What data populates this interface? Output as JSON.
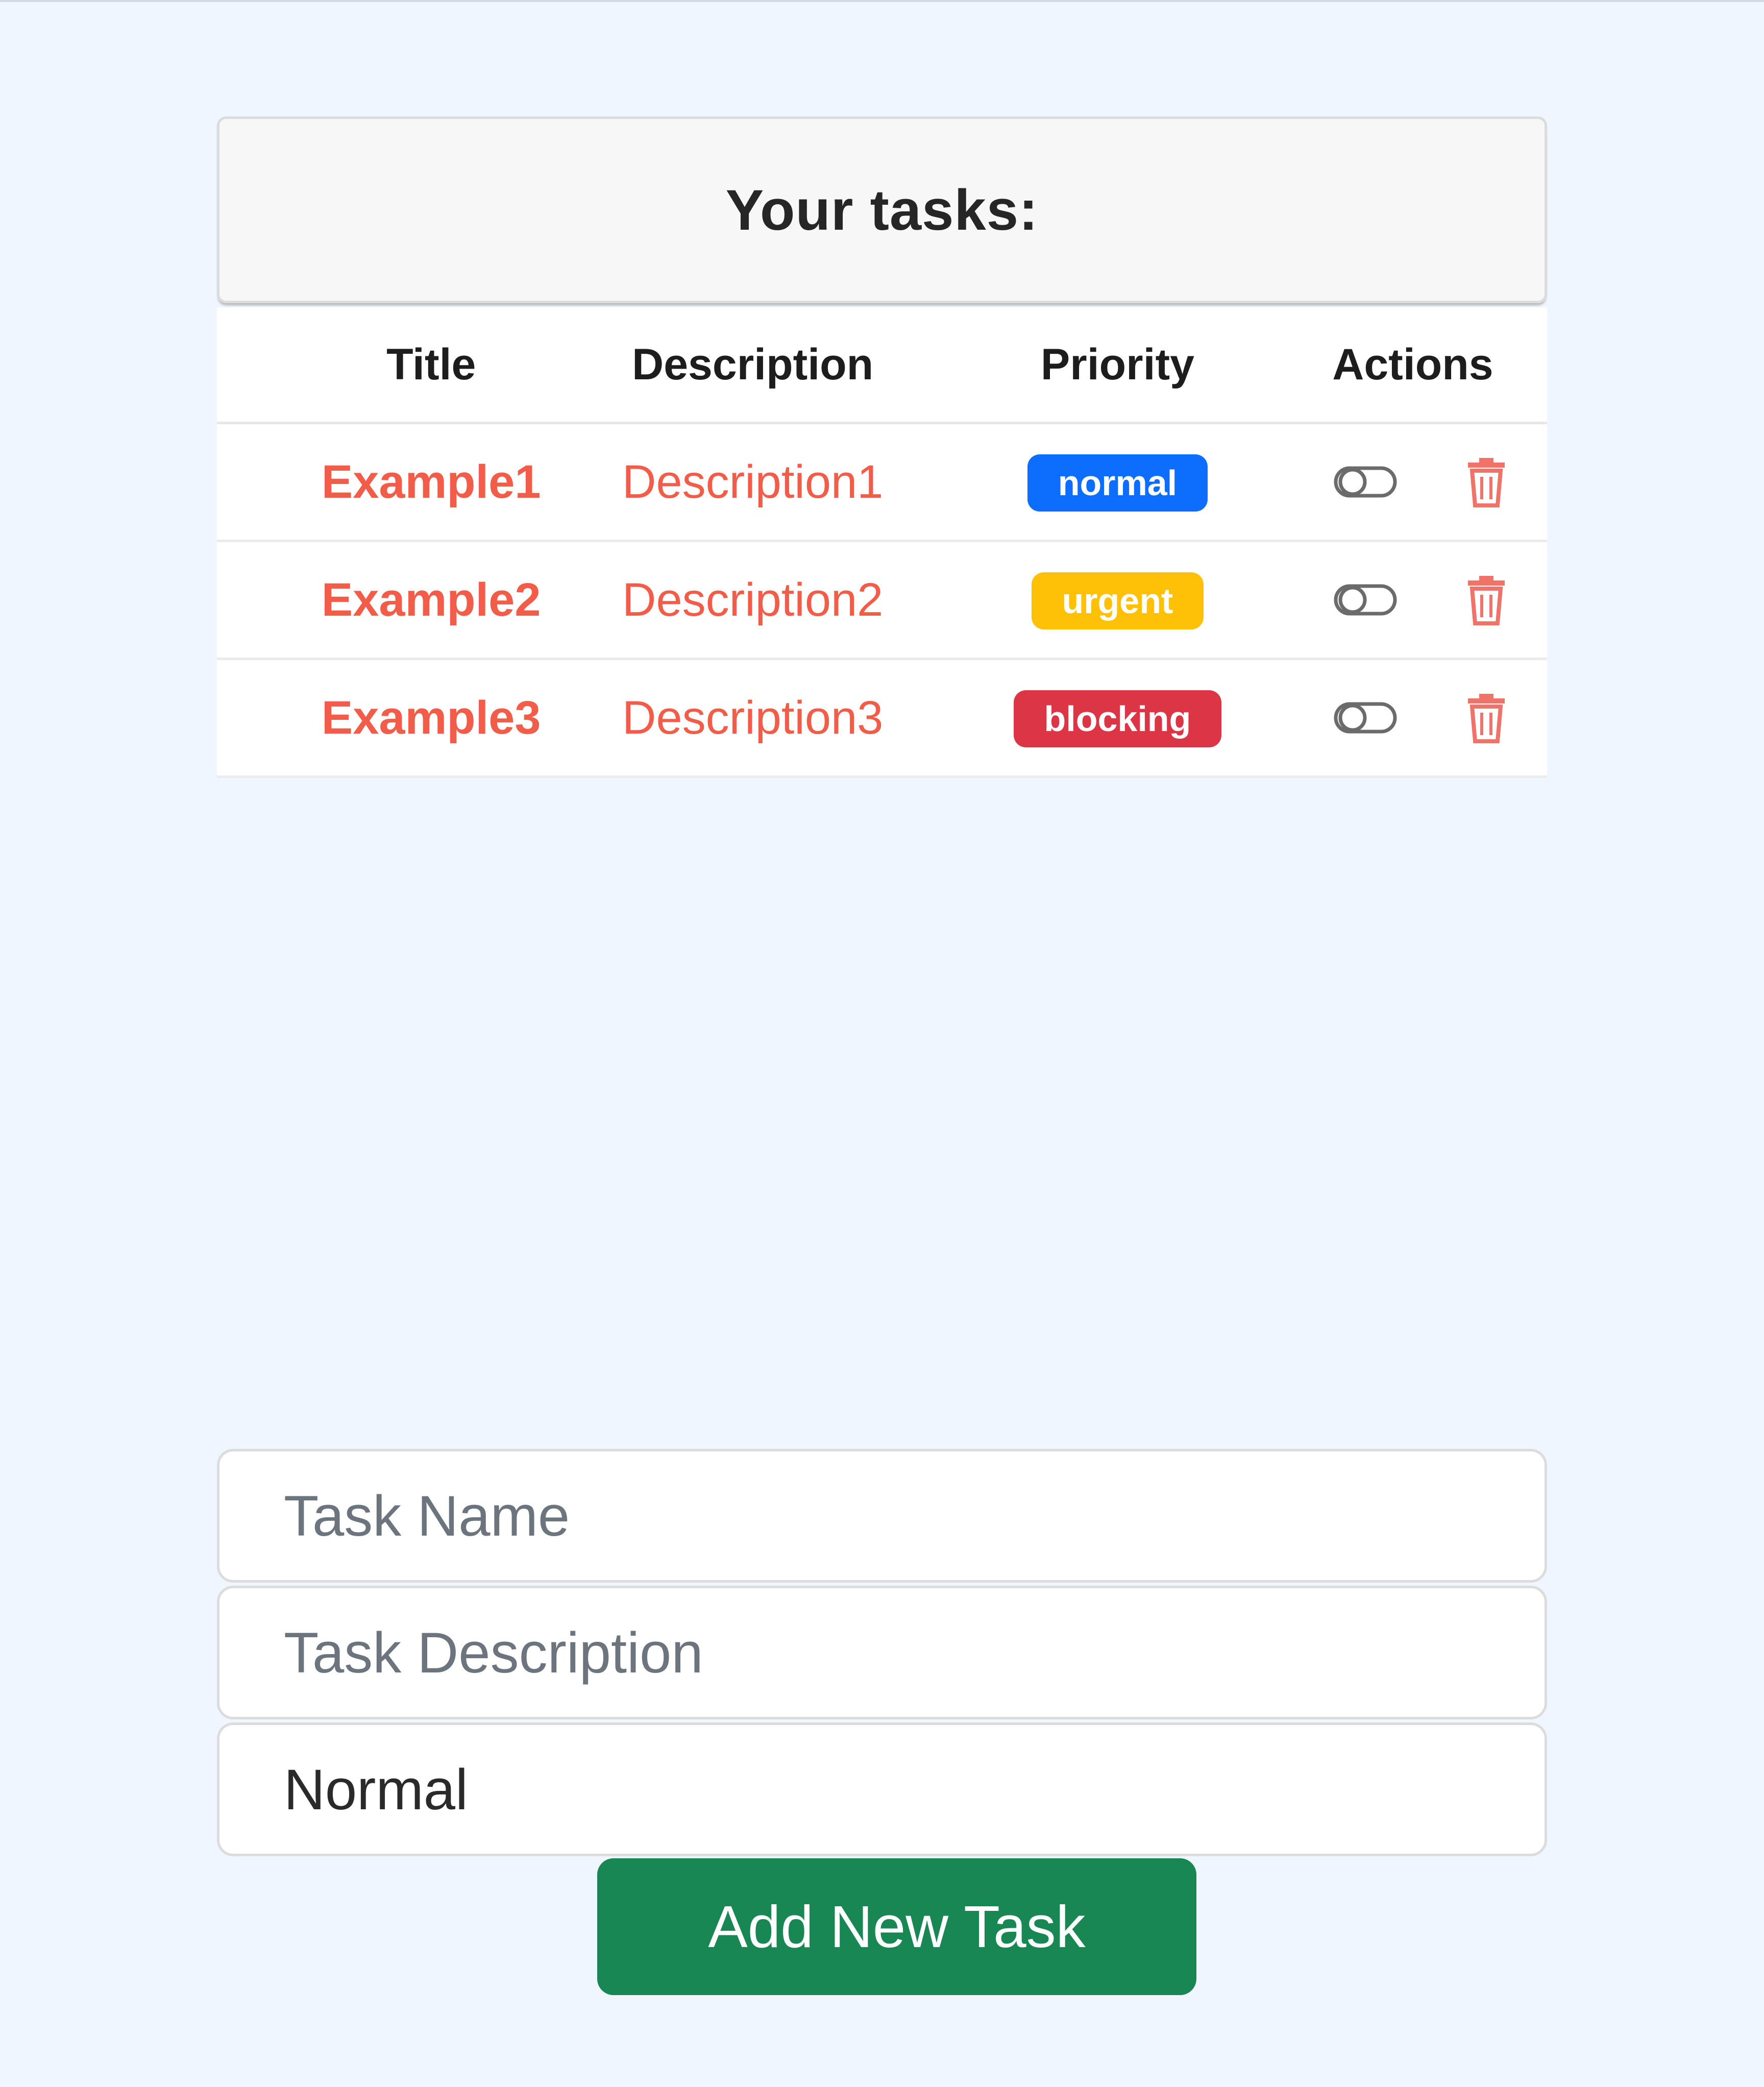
{
  "card": {
    "header": "Your tasks:"
  },
  "table": {
    "columns": [
      "Title",
      "Description",
      "Priority",
      "Actions"
    ],
    "rows": [
      {
        "title": "Example1",
        "description": "Description1",
        "priority": "normal",
        "priority_color": "#0d6efd"
      },
      {
        "title": "Example2",
        "description": "Description2",
        "priority": "urgent",
        "priority_color": "#ffc107"
      },
      {
        "title": "Example3",
        "description": "Description3",
        "priority": "blocking",
        "priority_color": "#dc3545"
      }
    ],
    "action_icons": [
      "toggle-icon",
      "trash-icon"
    ]
  },
  "form": {
    "name_placeholder": "Task Name",
    "description_placeholder": "Task Description",
    "priority_value": "Normal",
    "submit_label": "Add New Task"
  },
  "colors": {
    "background": "#eff6ff",
    "title_text": "#f25d4a",
    "submit": "#198754",
    "trash": "#f0736a"
  }
}
